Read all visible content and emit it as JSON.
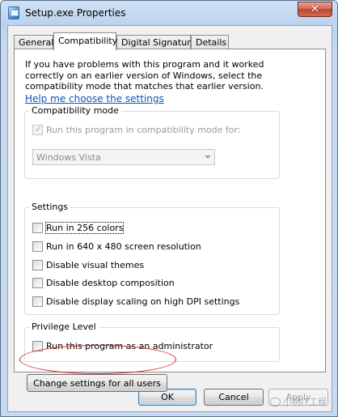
{
  "window": {
    "title": "Setup.exe Properties",
    "close_symbol": "✕"
  },
  "tabs": [
    {
      "label": "General"
    },
    {
      "label": "Compatibility"
    },
    {
      "label": "Digital Signatures"
    },
    {
      "label": "Details"
    }
  ],
  "active_tab": "Compatibility",
  "intro_text": "If you have problems with this program and it worked correctly on an earlier version of Windows, select the compatibility mode that matches that earlier version.",
  "help_link": "Help me choose the settings",
  "compat_mode": {
    "legend": "Compatibility mode",
    "checkbox_label": "Run this program in compatibility mode for:",
    "checkbox_checked": true,
    "select_value": "Windows Vista"
  },
  "settings": {
    "legend": "Settings",
    "items": [
      {
        "label": "Run in 256 colors",
        "checked": false
      },
      {
        "label": "Run in 640 x 480 screen resolution",
        "checked": false
      },
      {
        "label": "Disable visual themes",
        "checked": false
      },
      {
        "label": "Disable desktop composition",
        "checked": false
      },
      {
        "label": "Disable display scaling on high DPI settings",
        "checked": false
      }
    ]
  },
  "privilege": {
    "legend": "Privilege Level",
    "checkbox_label": "Run this program as an administrator",
    "checked": false
  },
  "change_settings_button": "Change settings for all users",
  "buttons": {
    "ok": "OK",
    "cancel": "Cancel",
    "apply": "Apply"
  },
  "watermark": "小明IT工程",
  "colors": {
    "link": "#0b56b7",
    "annotation_ellipse": "#e02020",
    "default_button_border": "#3c7fb1"
  }
}
